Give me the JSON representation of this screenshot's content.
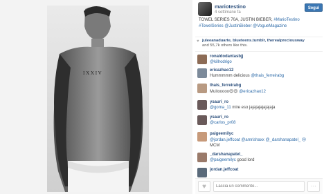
{
  "post": {
    "username": "mariotestino",
    "time": "4 settimane fa",
    "follow_label": "Segui",
    "caption_plain": "TOWEL SERIES 70A, JUSTIN BIEBER,",
    "caption_tag1": "#MarioTestino",
    "caption_tag2": "#TowelSeries",
    "caption_tag3": "@JustinBieber",
    "caption_tag4": "@VogueMagazine"
  },
  "likes": {
    "users": "juleeanaduarte, blueteens.tumblr, therealpreciousway",
    "count": "and 55,7k",
    "suffix": "others like this."
  },
  "comments": [
    {
      "user": "ronaldodantasbjj",
      "text": "",
      "mention": "@killrodrigo"
    },
    {
      "user": "ericazhao12",
      "text": "Hummmmm delicious",
      "mention": "@thais_ferreirabg"
    },
    {
      "user": "thais_ferreirabg",
      "text": "Muitooooo😍😍",
      "mention": "@ericazhao12"
    },
    {
      "user": "ysauri_ro",
      "text": "mire eso jajajajajajajaja",
      "mention": "@goma_11"
    },
    {
      "user": "ysauri_ro",
      "text": "",
      "mention": "@carlos_pr08"
    },
    {
      "user": "paigeemilyc",
      "text": "",
      "mention": "@jordan.jeffcoat @amrishaxx @_darshanapatel_ 😢"
    },
    {
      "user": "",
      "text": "MCM",
      "mention": ""
    },
    {
      "user": "_darshanapatel_",
      "text": "",
      "mention": "@paigeemilyc"
    },
    {
      "user": "",
      "text": "good lord",
      "mention": ""
    },
    {
      "user": "jordan.jeffcoat",
      "text": "",
      "mention": ""
    }
  ],
  "footer": {
    "placeholder": "Lascia un commento...",
    "more_icon": "···"
  },
  "colors": {
    "accent": "#3b77b3",
    "link": "#2c4f7c"
  }
}
